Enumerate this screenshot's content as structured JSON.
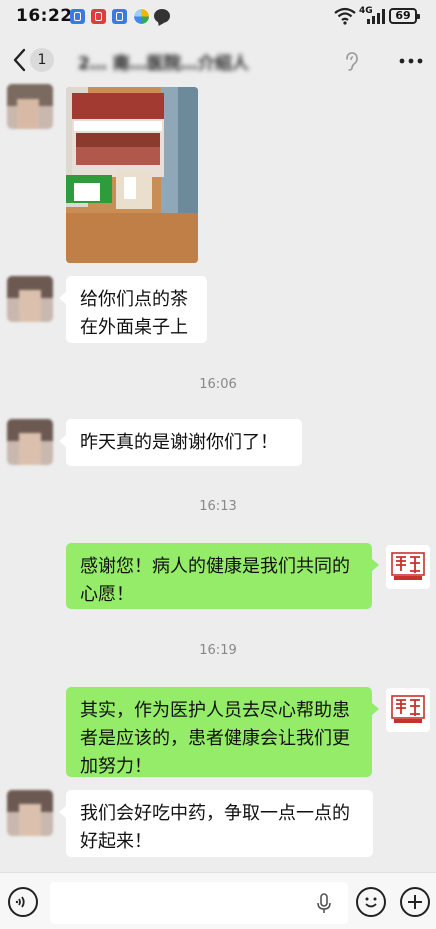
{
  "status_bar": {
    "time": "16:22",
    "network": "4G",
    "battery": "69"
  },
  "header": {
    "back_count": "1",
    "title": "2… 南…医院…介绍人"
  },
  "messages": [
    {
      "side": "left",
      "text": "给你们点的茶\n在外面桌子上"
    },
    {
      "timestamp": "16:06"
    },
    {
      "side": "left",
      "text": "昨天真的是谢谢你们了！"
    },
    {
      "timestamp": "16:13"
    },
    {
      "side": "right",
      "text": "感谢您！病人的健康是我们共同的心愿！"
    },
    {
      "timestamp": "16:19"
    },
    {
      "side": "right",
      "text": "其实，作为医护人员去尽心帮助患者是应该的，患者健康会让我们更加努力！"
    },
    {
      "side": "left",
      "text": "我们会好吃中药，争取一点一点的好起来！"
    }
  ],
  "input_bar": {
    "placeholder": ""
  },
  "colors": {
    "background": "#ededed",
    "sent_bubble": "#95ec69",
    "received_bubble": "#ffffff",
    "seal_red": "#c8312c"
  },
  "icons": [
    "voice-icon",
    "microphone-icon",
    "emoji-icon",
    "plus-icon",
    "back-arrow-icon",
    "ear-icon",
    "more-icon"
  ]
}
